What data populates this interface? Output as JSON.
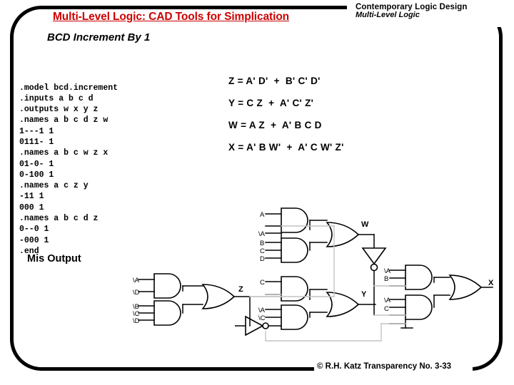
{
  "header": {
    "line1": "Contemporary Logic Design",
    "line2": "Multi-Level Logic"
  },
  "title": "Multi-Level Logic: CAD Tools for Simplication",
  "subtitle": "BCD Increment By 1",
  "code": {
    "text": ".model bcd.increment\n.inputs a b c d\n.outputs w x y z\n.names a b c d z w\n1---1 1\n0111- 1\n.names a b c w z x\n01-0- 1\n0-100 1\n.names a c z y\n-11 1\n000 1\n.names a b c d z\n0--0 1\n-000 1\n.end"
  },
  "mis_output_label": "Mis Output",
  "equations": [
    "Z = A' D'  +  B' C' D'",
    "Y = C Z  +  A' C' Z'",
    "W = A Z  +  A' B C D",
    "X = A' B W'  +  A' C W' Z'"
  ],
  "footer": "© R.H. Katz   Transparency No. 3-33",
  "circuit": {
    "labels": {
      "z_out": "Z",
      "w_out": "W",
      "y_out": "Y",
      "x_out": "X",
      "and_z1": [
        "\\A",
        "\\D"
      ],
      "and_z2": [
        "\\B",
        "\\C",
        "\\D"
      ],
      "and_w1": [
        "A"
      ],
      "and_w2": [
        "\\A",
        "B",
        "C",
        "D"
      ],
      "and_y1": [
        "C"
      ],
      "and_y2": [
        "\\A",
        "\\C"
      ],
      "and_x1": [
        "\\A",
        "B"
      ],
      "and_x2": [
        "\\A",
        "C"
      ]
    },
    "colors": {
      "wire": "#000000",
      "feedback_wire": "#b9b9b9"
    }
  }
}
